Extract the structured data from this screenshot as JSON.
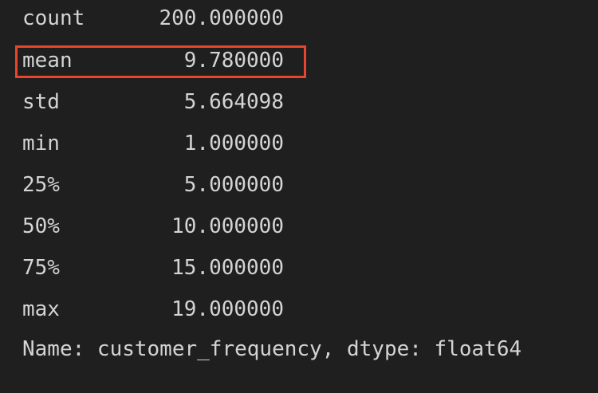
{
  "describe_output": {
    "rows": [
      {
        "label": "count",
        "value": "200.000000"
      },
      {
        "label": "mean",
        "value": "9.780000"
      },
      {
        "label": "std",
        "value": "5.664098"
      },
      {
        "label": "min",
        "value": "1.000000"
      },
      {
        "label": "25%",
        "value": "5.000000"
      },
      {
        "label": "50%",
        "value": "10.000000"
      },
      {
        "label": "75%",
        "value": "15.000000"
      },
      {
        "label": "max",
        "value": "19.000000"
      }
    ],
    "footer": "Name: customer_frequency, dtype: float64",
    "highlight_color": "#e8442e",
    "background_color": "#1f1f1f",
    "text_color": "#d4d4d4"
  }
}
